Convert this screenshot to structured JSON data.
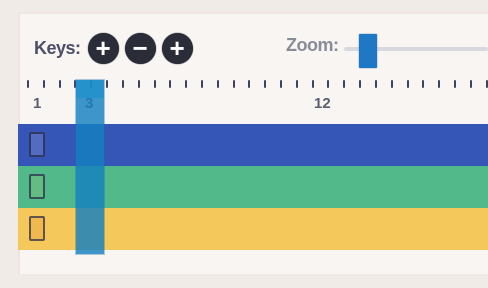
{
  "toolbar": {
    "keys_label": "Keys:",
    "buttons": [
      {
        "symbol": "+",
        "icon": "plus-icon"
      },
      {
        "symbol": "−",
        "icon": "minus-icon"
      },
      {
        "symbol": "+",
        "icon": "plus-icon"
      }
    ],
    "zoom_label": "Zoom:",
    "zoom_value_fraction": 0.12
  },
  "ruler": {
    "labels": [
      "1",
      "3",
      "12"
    ]
  },
  "tracks": [
    {
      "name": "blue-track",
      "color": "#3556b7"
    },
    {
      "name": "green-track",
      "color": "#52b98a"
    },
    {
      "name": "yellow-track",
      "color": "#f4c85a"
    }
  ],
  "playhead": {
    "color": "#1380c0"
  }
}
